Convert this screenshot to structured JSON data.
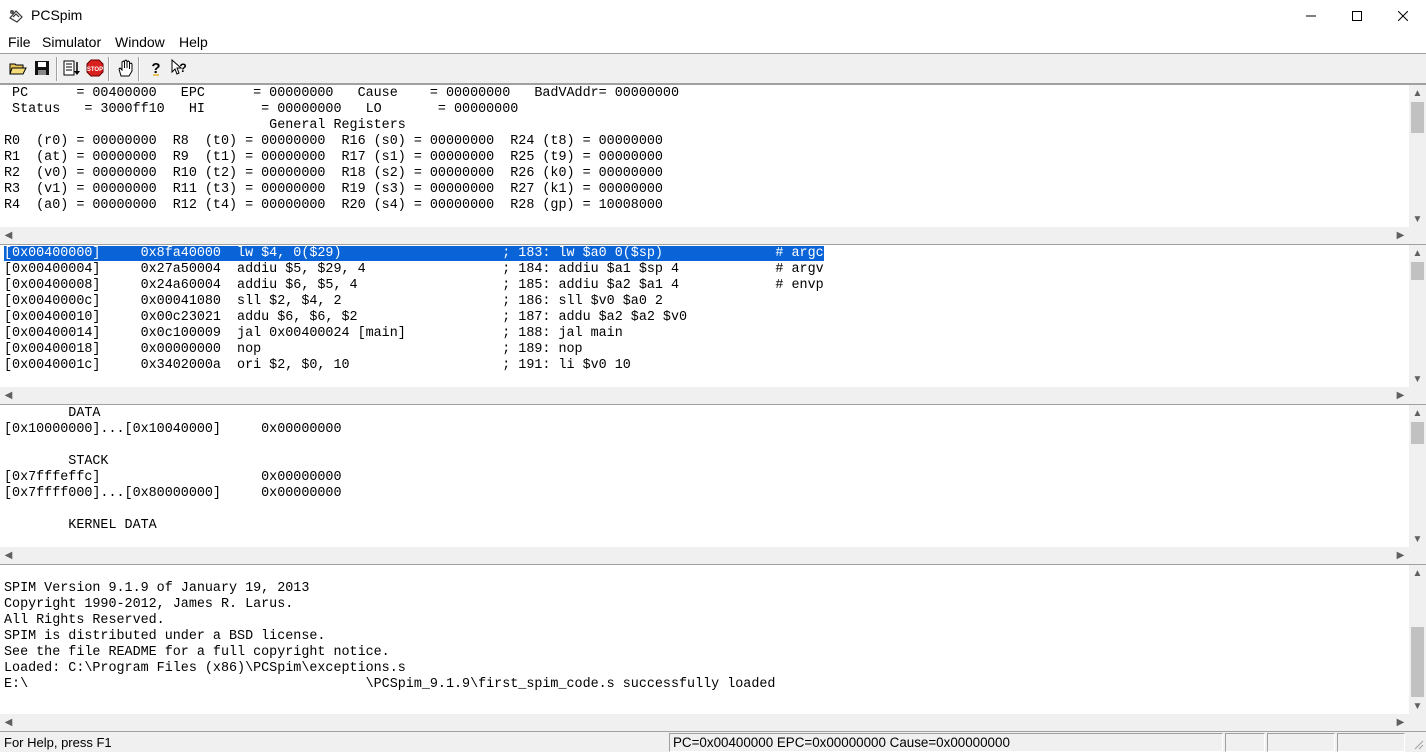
{
  "window": {
    "title": "PCSpim"
  },
  "menu": [
    "File",
    "Simulator",
    "Window",
    "Help"
  ],
  "toolbar_icons": [
    "open-file-icon",
    "save-icon",
    "run-icon",
    "stop-icon",
    "breakpoint-hand-icon",
    "help-icon",
    "context-help-icon"
  ],
  "registers": {
    "text": " PC      = 00400000   EPC      = 00000000   Cause    = 00000000   BadVAddr= 00000000\n Status   = 3000ff10   HI       = 00000000   LO       = 00000000\n                                 General Registers\nR0  (r0) = 00000000  R8  (t0) = 00000000  R16 (s0) = 00000000  R24 (t8) = 00000000\nR1  (at) = 00000000  R9  (t1) = 00000000  R17 (s1) = 00000000  R25 (t9) = 00000000\nR2  (v0) = 00000000  R10 (t2) = 00000000  R18 (s2) = 00000000  R26 (k0) = 00000000\nR3  (v1) = 00000000  R11 (t3) = 00000000  R19 (s3) = 00000000  R27 (k1) = 00000000\nR4  (a0) = 00000000  R12 (t4) = 00000000  R20 (s4) = 00000000  R28 (gp) = 10008000"
  },
  "text_segment": {
    "selected": "[0x00400000]     0x8fa40000  lw $4, 0($29)                    ; 183: lw $a0 0($sp)              # argc",
    "rest": "[0x00400004]     0x27a50004  addiu $5, $29, 4                 ; 184: addiu $a1 $sp 4            # argv\n[0x00400008]     0x24a60004  addiu $6, $5, 4                  ; 185: addiu $a2 $a1 4            # envp\n[0x0040000c]     0x00041080  sll $2, $4, 2                    ; 186: sll $v0 $a0 2\n[0x00400010]     0x00c23021  addu $6, $6, $2                  ; 187: addu $a2 $a2 $v0\n[0x00400014]     0x0c100009  jal 0x00400024 [main]            ; 188: jal main\n[0x00400018]     0x00000000  nop                              ; 189: nop\n[0x0040001c]     0x3402000a  ori $2, $0, 10                   ; 191: li $v0 10"
  },
  "data_segment": {
    "text": "        DATA\n[0x10000000]...[0x10040000]     0x00000000\n\n        STACK\n[0x7fffeffc]                    0x00000000\n[0x7ffff000]...[0x80000000]     0x00000000\n\n        KERNEL DATA"
  },
  "messages": {
    "text": "SPIM Version 9.1.9 of January 19, 2013\nCopyright 1990-2012, James R. Larus.\nAll Rights Reserved.\nSPIM is distributed under a BSD license.\nSee the file README for a full copyright notice.\nLoaded: C:\\Program Files (x86)\\PCSpim\\exceptions.s\nE:\\                                          \\PCSpim_9.1.9\\first_spim_code.s successfully loaded"
  },
  "status": {
    "help": "For Help, press F1",
    "regs": "PC=0x00400000  EPC=0x00000000  Cause=0x00000000"
  }
}
